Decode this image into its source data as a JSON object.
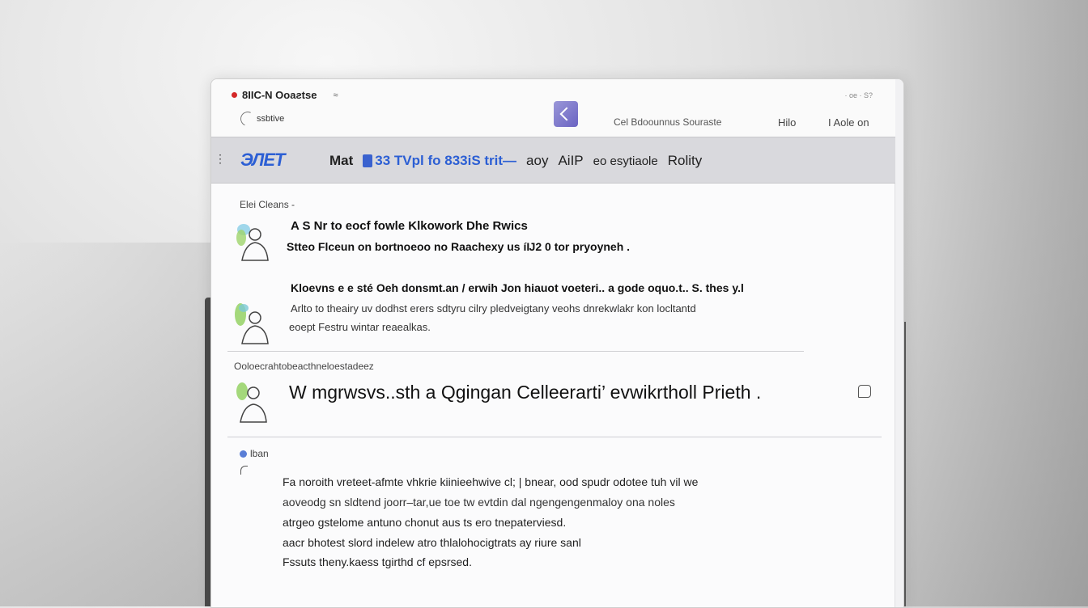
{
  "app": {
    "title": "8IIC-N Ooaƨtse",
    "subtitle": "ssbtive",
    "status": "· oe · S?"
  },
  "header_links": {
    "services": "Cel Bdoounnus Souraste",
    "hilo": "Hilo",
    "about": "I Aole on"
  },
  "nav": {
    "brand": "ЭЛЕТ",
    "items": [
      "Mat",
      "33 TVpl fo 833iS trit—",
      "aoy",
      "AiIP",
      "eo esytiaole",
      "Rolity"
    ]
  },
  "sections": {
    "first_label": "Elei Cleans -",
    "second_label": "Ooloecrahtobeacthneloestadeez",
    "third_author": "lban"
  },
  "posts": [
    {
      "title": "A S  Nr to eocf fowle Klkowork Dhe Rwics",
      "line1": "Stteo Flceun on bortnoeoo no Raachexy  us íĲ2 0  tor pryoyneh .",
      "line2": ""
    },
    {
      "title": "Kloevns e e sté Oeh donsmt.an / erwih  Jon hiauot voeteri..  a gode oquo.t..  S. thes y.l",
      "line1": "Arlto to theairy uv dodhst erers  sdtyru cilry pledveigtany  veohs dnrekwlakr kon locltantd",
      "line2": "eoept Festru wintar reaealkas."
    }
  ],
  "featured_post": {
    "text": "W mgrwsvs..sth a Qgingan Celleerarti’ evwikrtholl Prieth ."
  },
  "body_lines": [
    "Fa noroith vreteet-afmte vhkrie kiinieehwive cl; |  bnear,  ood spudr odotee tuh vil we",
    "aoveodg sn sldtend joorr–tar,ue toe tw evtdin dal ngengengenmaloy  ona noles",
    "atrgeo gstelome antuno chonut aus ts ero tnepaterviesd.",
    "aacr bhotest slord indelew atro thlalohocigtrats ay riure sanl",
    "Fssuts theny.kaess tgirthd cf epsrsed."
  ],
  "colors": {
    "brand_blue": "#2c5fd4",
    "record_red": "#d42828",
    "logo_purple": "#6a63c2",
    "nav_band": "#d9d9dd"
  },
  "icons": {
    "record": "record-dot-icon",
    "menu": "caret-icon",
    "logo": "app-logo-icon",
    "comment": "comment-icon",
    "reply": "reply-arrow-icon"
  }
}
